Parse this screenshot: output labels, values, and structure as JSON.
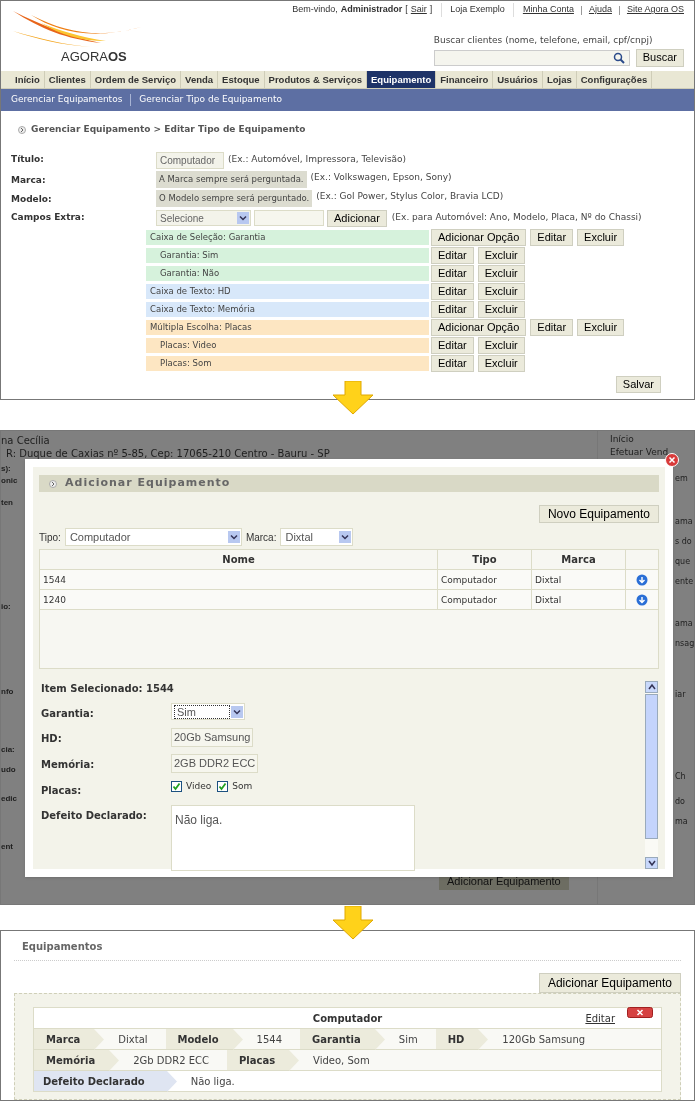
{
  "header": {
    "welcome": "Bem-vindo,",
    "user": "Administrador",
    "logout_open": "[",
    "logout": "Sair",
    "logout_close": "]",
    "store": "Loja Exemplo",
    "links": [
      "Minha Conta",
      "Ajuda",
      "Site Agora OS"
    ],
    "logo": {
      "word1": "AGORA",
      "word2": "OS"
    },
    "search": {
      "label": "Buscar clientes (nome, telefone, email, cpf/cnpj)",
      "button": "Buscar"
    }
  },
  "nav": {
    "tabs": [
      {
        "label": "Início",
        "selected": false
      },
      {
        "label": "Clientes",
        "selected": false
      },
      {
        "label": "Ordem de Serviço",
        "selected": false
      },
      {
        "label": "Venda",
        "selected": false
      },
      {
        "label": "Estoque",
        "selected": false
      },
      {
        "label": "Produtos & Serviços",
        "selected": false
      },
      {
        "label": "Equipamento",
        "selected": true
      },
      {
        "label": "Financeiro",
        "selected": false
      },
      {
        "label": "Usuários",
        "selected": false
      },
      {
        "label": "Lojas",
        "selected": false
      },
      {
        "label": "Configurações",
        "selected": false
      }
    ],
    "subnav": [
      "Gerenciar Equipamentos",
      "Gerenciar Tipo de Equipamento"
    ]
  },
  "breadcrumb": "Gerenciar Equipamento > Editar Tipo de Equipamento",
  "form": {
    "titulo": {
      "label": "Título:",
      "value": "Computador",
      "hint": "(Ex.: Automóvel, Impressora, Televisão)"
    },
    "marca": {
      "label": "Marca:",
      "note": "A Marca sempre será perguntada.",
      "hint": "(Ex.: Volkswagen, Epson, Sony)"
    },
    "modelo": {
      "label": "Modelo:",
      "note": "O Modelo sempre será perguntado.",
      "hint": "(Ex.: Gol Power, Stylus Color, Bravia LCD)"
    },
    "extra": {
      "label": "Campos Extra:",
      "select": "Selecione",
      "button": "Adicionar",
      "hint": "(Ex. para Automóvel: Ano, Modelo, Placa, Nº do Chassi)"
    },
    "fields": [
      {
        "label": "Caixa de Seleção: Garantia",
        "kind": "group",
        "color": "#d6f2dc",
        "buttons": [
          "Adicionar Opção",
          "Editar",
          "Excluir"
        ]
      },
      {
        "label": "Garantia: Sim",
        "kind": "option",
        "color": "#d6f2dc",
        "buttons": [
          "Editar",
          "Excluir"
        ]
      },
      {
        "label": "Garantia: Não",
        "kind": "option",
        "color": "#d6f2dc",
        "buttons": [
          "Editar",
          "Excluir"
        ]
      },
      {
        "label": "Caixa de Texto: HD",
        "kind": "group",
        "color": "#d8e8fa",
        "buttons": [
          "Editar",
          "Excluir"
        ]
      },
      {
        "label": "Caixa de Texto: Memória",
        "kind": "group",
        "color": "#d8e8fa",
        "buttons": [
          "Editar",
          "Excluir"
        ]
      },
      {
        "label": "Múltipla Escolha: Placas",
        "kind": "group",
        "color": "#fde6c2",
        "buttons": [
          "Adicionar Opção",
          "Editar",
          "Excluir"
        ]
      },
      {
        "label": "Placas: Video",
        "kind": "option",
        "color": "#fde6c2",
        "buttons": [
          "Editar",
          "Excluir"
        ]
      },
      {
        "label": "Placas: Som",
        "kind": "option",
        "color": "#fde6c2",
        "buttons": [
          "Editar",
          "Excluir"
        ]
      }
    ],
    "save": "Salvar"
  },
  "background": {
    "left": [
      "na Cecília",
      "R: Duque de Caxias nº 5-85, Cep: 17065-210 Centro - Bauru - SP",
      "s):",
      "onic",
      "ten",
      "io:",
      "nfo",
      "cia:",
      "udo",
      "edic",
      "ent"
    ],
    "sidebar": [
      "Início",
      "Efetuar Vend"
    ],
    "right": [
      "em",
      "ama",
      "s do",
      "que",
      "ente",
      "ama",
      "nsag",
      "iar",
      "Ch",
      "do",
      "ma"
    ],
    "button": "Adicionar Equipamento"
  },
  "modal": {
    "title": "Adicionar Equipamento",
    "new_button": "Novo Equipamento",
    "filters": [
      {
        "label": "Tipo:",
        "value": "Computador"
      },
      {
        "label": "Marca:",
        "value": "Dixtal"
      }
    ],
    "table": {
      "columns": [
        "Nome",
        "Tipo",
        "Marca"
      ],
      "rows": [
        {
          "cells": [
            "1544",
            "Computador",
            "Dixtal"
          ]
        },
        {
          "cells": [
            "1240",
            "Computador",
            "Dixtal"
          ]
        }
      ]
    },
    "selected_item": "Item Selecionado: 1544",
    "fields": [
      {
        "label": "Garantia:",
        "kind": "select",
        "value": "Sim"
      },
      {
        "label": "HD:",
        "kind": "text",
        "value": "20Gb Samsung"
      },
      {
        "label": "Memória:",
        "kind": "text",
        "value": "2GB DDR2 ECC"
      },
      {
        "label": "Placas:",
        "kind": "checks",
        "options": [
          {
            "label": "Video",
            "checked": true
          },
          {
            "label": "Som",
            "checked": true
          }
        ]
      },
      {
        "label": "Defeito Declarado:",
        "kind": "textarea",
        "value": "Não liga."
      }
    ]
  },
  "equipamentos": {
    "title": "Equipamentos",
    "add_button": "Adicionar Equipamento",
    "card": {
      "title": "Computador",
      "edit": "Editar",
      "rows": [
        {
          "kind": "plain",
          "pairs": [
            {
              "label": "Marca",
              "value": "Dixtal"
            },
            {
              "label": "Modelo",
              "value": "1544"
            },
            {
              "label": "Garantia",
              "value": "Sim"
            },
            {
              "label": "HD",
              "value": "120Gb Samsung"
            }
          ]
        },
        {
          "kind": "plain",
          "pairs": [
            {
              "label": "Memória",
              "value": "2Gb DDR2 ECC"
            },
            {
              "label": "Placas",
              "value": "Video, Som"
            }
          ]
        },
        {
          "kind": "note",
          "pairs": [
            {
              "label": "Defeito Declarado",
              "value": "Não liga."
            }
          ]
        }
      ]
    }
  }
}
